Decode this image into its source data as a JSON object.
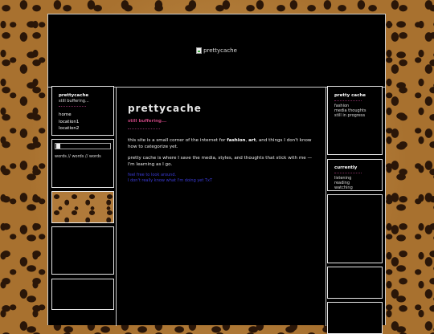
{
  "header": {
    "image_alt": "prettycache"
  },
  "left_panel": {
    "title": "prettycache",
    "subtitle": "still buffering...",
    "nav": [
      "home",
      "location1",
      "location2"
    ]
  },
  "left_widget": {
    "words": "words // words // words"
  },
  "main": {
    "title": "prettycache",
    "subtitle": "still buffering...",
    "para1_before": "this site is a small corner of the internet for ",
    "para1_bold1": "fashion",
    "para1_mid": ", ",
    "para1_bold2": "art",
    "para1_after": ", and things I don't know how to categorize yet.",
    "para2": "pretty cache is where I save the media, styles, and thoughts that stick with me — I'm learning as I go.",
    "links": [
      "feel free to look around.",
      "I don't really know what I'm doing yet TxT"
    ]
  },
  "right_panel": {
    "title": "pretty cache",
    "items": [
      "fashion",
      "media thoughts",
      "still in progress"
    ]
  },
  "currently": {
    "title": "currently",
    "items": [
      "listening",
      "reading",
      "watching"
    ]
  }
}
